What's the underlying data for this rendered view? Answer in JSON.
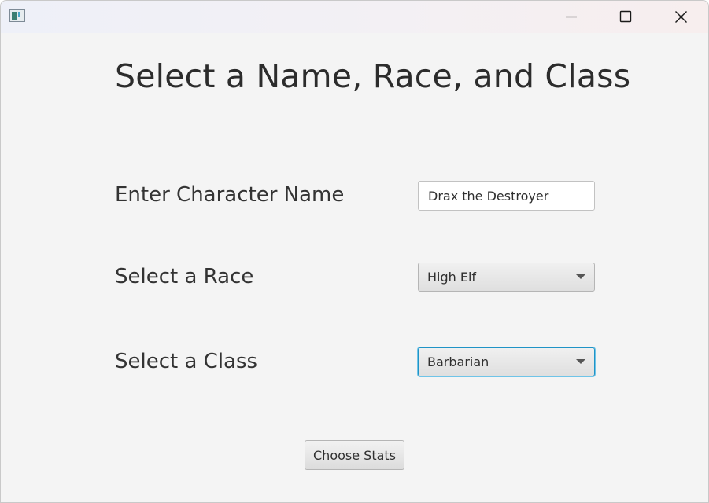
{
  "window": {
    "app_icon": "java-app-icon",
    "controls": {
      "minimize_icon": "minimize-icon",
      "maximize_icon": "maximize-icon",
      "close_icon": "close-icon"
    }
  },
  "main": {
    "heading": "Select a Name, Race, and Class",
    "name_label": "Enter Character Name",
    "name_value": "Drax the Destroyer",
    "race_label": "Select a Race",
    "race_selected": "High Elf",
    "class_label": "Select a Class",
    "class_selected": "Barbarian",
    "choose_stats_label": "Choose Stats"
  },
  "colors": {
    "window_background": "#f4f4f4",
    "focus_ring": "#1f93c6",
    "text": "#333333"
  }
}
